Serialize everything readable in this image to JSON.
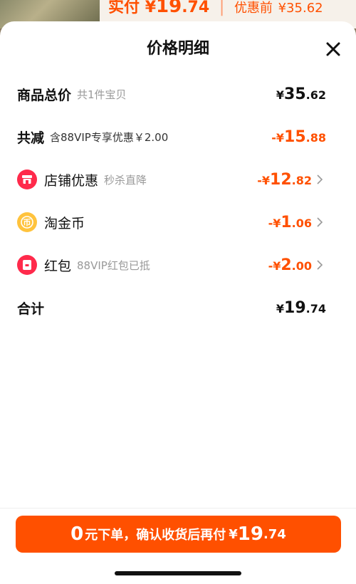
{
  "background": {
    "actual_label": "实付",
    "actual_yen": "¥",
    "actual_int": "19",
    "actual_dec": ".74",
    "orig_label": "优惠前",
    "orig_price": "¥35.62"
  },
  "sheet": {
    "title": "价格明细",
    "rows": [
      {
        "label": "商品总价",
        "sub": "共1件宝贝",
        "yen": "¥",
        "int": "35",
        "dec": ".62"
      },
      {
        "label": "共减",
        "sub": "含88VIP专享优惠￥2.00",
        "yen": "-¥",
        "int": "15",
        "dec": ".88"
      },
      {
        "label": "店铺优惠",
        "sub": "秒杀直降",
        "yen": "-¥",
        "int": "12",
        "dec": ".82",
        "icon": "shop-icon"
      },
      {
        "label": "淘金币",
        "sub": "",
        "yen": "-¥",
        "int": "1",
        "dec": ".06",
        "icon": "gold-coin-icon"
      },
      {
        "label": "红包",
        "sub": "88VIP红包已抵",
        "yen": "-¥",
        "int": "2",
        "dec": ".00",
        "icon": "red-packet-icon"
      },
      {
        "label": "合计",
        "sub": "",
        "yen": "¥",
        "int": "19",
        "dec": ".74"
      }
    ]
  },
  "cta": {
    "zero": "0",
    "text": "元下单，确认收货后再付",
    "yen": "¥",
    "int": "19",
    "dec": ".74"
  },
  "colors": {
    "accent": "#ff5000",
    "red_icon": "#ff2a4b",
    "coin_icon": "#ffc33d"
  }
}
